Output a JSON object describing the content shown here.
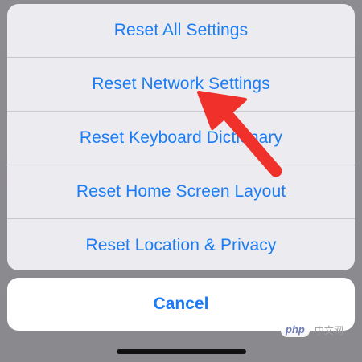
{
  "action_sheet": {
    "items": [
      {
        "label": "Reset All Settings"
      },
      {
        "label": "Reset Network Settings"
      },
      {
        "label": "Reset Keyboard Dictionary"
      },
      {
        "label": "Reset Home Screen Layout"
      },
      {
        "label": "Reset Location & Privacy"
      }
    ],
    "cancel_label": "Cancel",
    "accent_color": "#1a7df5"
  },
  "annotation": {
    "icon": "red-arrow-icon",
    "color": "#f0302b"
  },
  "watermark": {
    "badge": "php",
    "text": "中文网"
  }
}
